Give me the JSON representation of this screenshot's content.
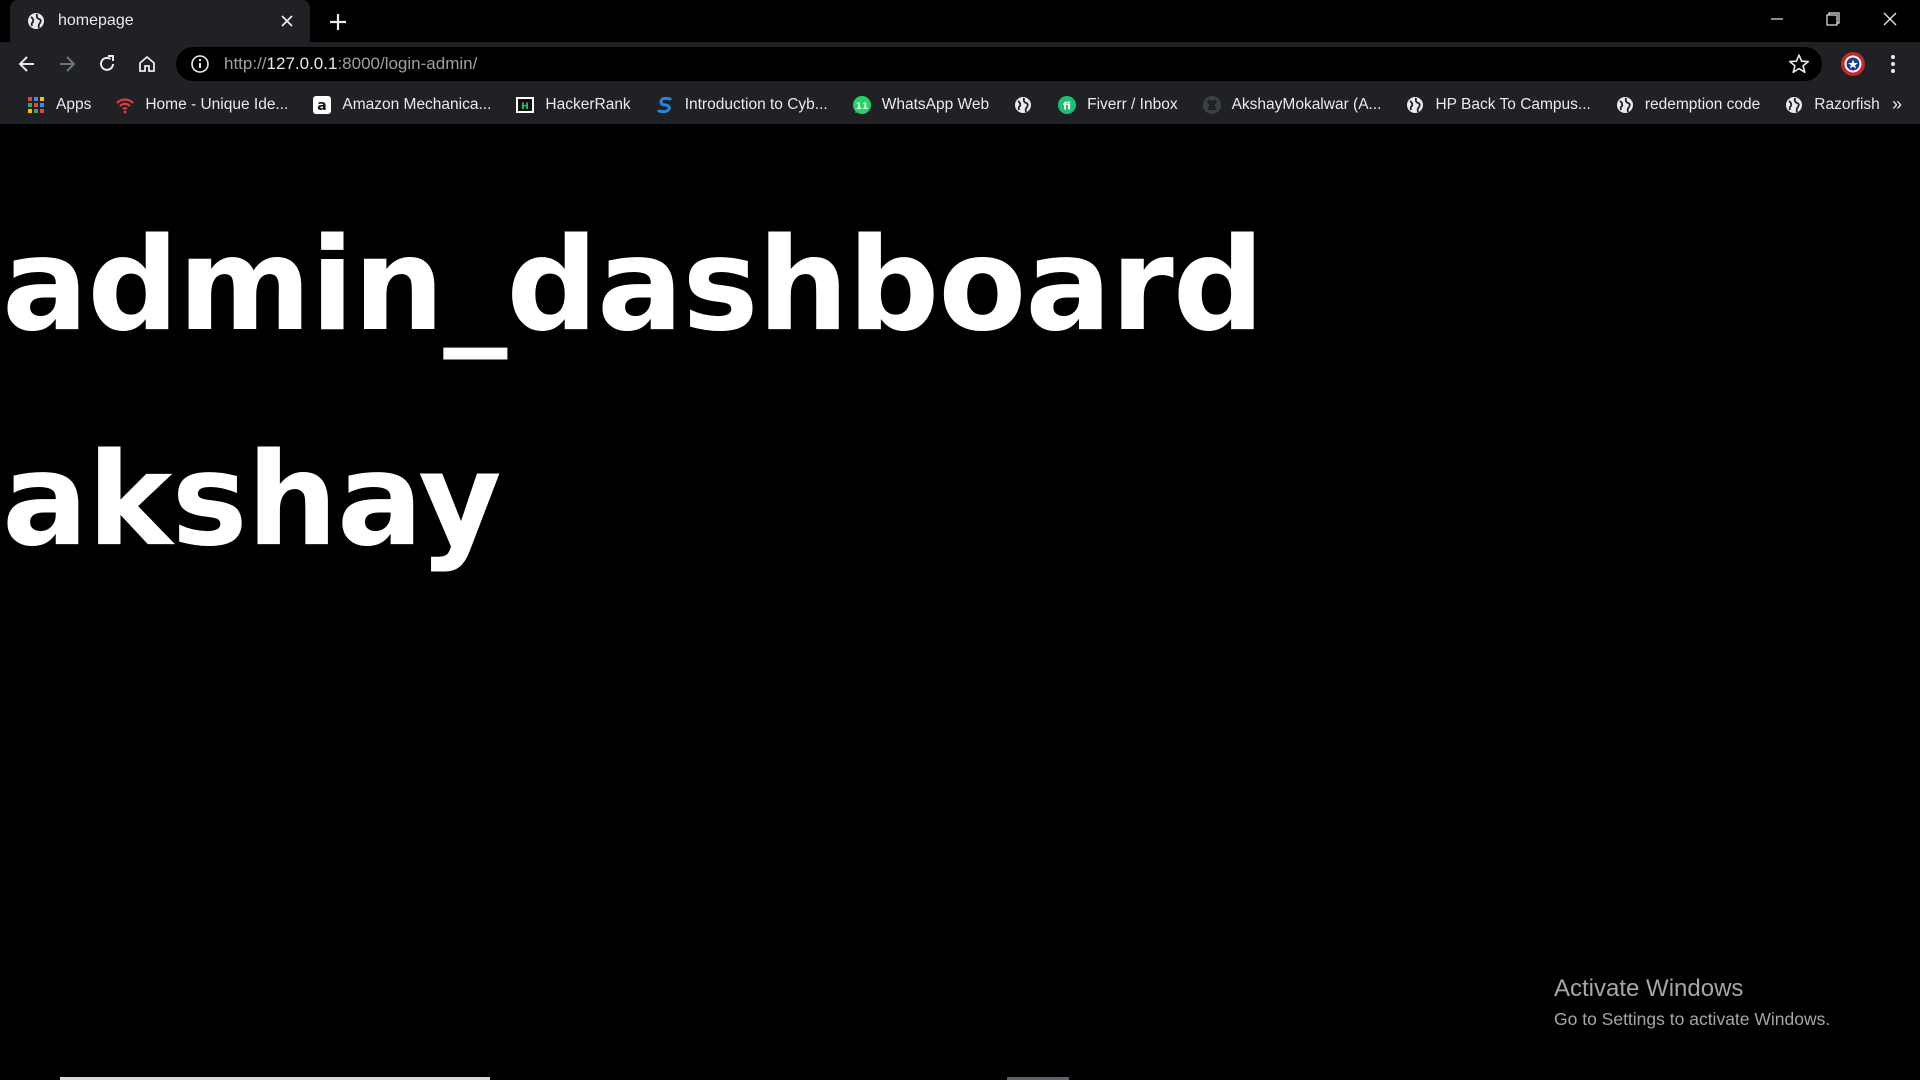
{
  "tab": {
    "title": "homepage",
    "favicon": "globe-icon"
  },
  "toolbar": {
    "url_scheme": "http://",
    "url_host": "127.0.0.1",
    "url_rest": ":8000/login-admin/"
  },
  "bookmarks": [
    {
      "label": "Apps",
      "icon": "apps-grid-icon"
    },
    {
      "label": "Home - Unique Ide...",
      "icon": "wifi-red-icon"
    },
    {
      "label": "Amazon Mechanica...",
      "icon": "amazon-icon"
    },
    {
      "label": "HackerRank",
      "icon": "hackerrank-icon"
    },
    {
      "label": "Introduction to Cyb...",
      "icon": "skillshare-icon"
    },
    {
      "label": "WhatsApp Web",
      "icon": "whatsapp-icon"
    },
    {
      "label": "",
      "icon": "globe-icon"
    },
    {
      "label": "Fiverr / Inbox",
      "icon": "fiverr-icon"
    },
    {
      "label": "AkshayMokalwar (A...",
      "icon": "github-icon"
    },
    {
      "label": "HP Back To Campus...",
      "icon": "globe-icon"
    },
    {
      "label": "redemption code",
      "icon": "globe-icon"
    },
    {
      "label": "Razorfish",
      "icon": "globe-icon"
    }
  ],
  "bookmarks_more": "»",
  "page": {
    "title": "admin_dashboard",
    "username": "akshay"
  },
  "watermark": {
    "line1": "Activate Windows",
    "line2": "Go to Settings to activate Windows."
  },
  "colors": {
    "background": "#000000",
    "chrome": "#202124",
    "text": "#ffffff",
    "whatsapp": "#25d366",
    "fiverr": "#1dbf73"
  }
}
